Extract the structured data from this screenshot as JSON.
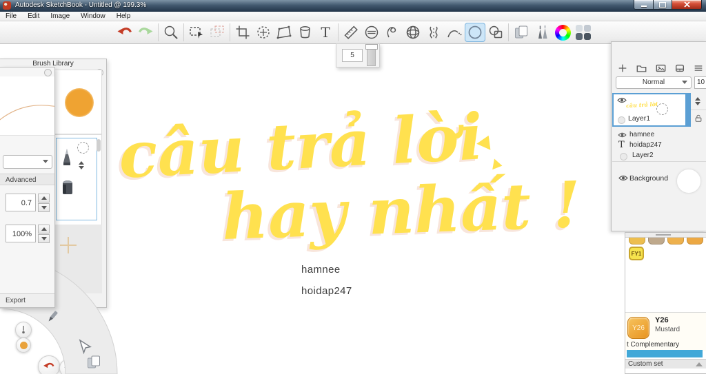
{
  "window": {
    "title": "Autodesk SketchBook - Untitled @ 199.3%"
  },
  "menu_bar": {
    "items": [
      "File",
      "Edit",
      "Image",
      "Window",
      "Help"
    ]
  },
  "toolbar": {
    "icons": [
      "undo",
      "redo",
      "zoom",
      "selection",
      "deselect",
      "crop",
      "transform",
      "distort",
      "fill",
      "text",
      "ruler",
      "ellipse-guide",
      "french-curve",
      "perspective",
      "symmetry",
      "steady-stroke",
      "ellipse",
      "shapes",
      "layer-copy",
      "brush-palette",
      "color-wheel",
      "swatch-grid"
    ],
    "active_tool": "ellipse"
  },
  "glyphs": {
    "text_tool": "T",
    "text_layer": "T"
  },
  "brush_size_popup": {
    "value": "5"
  },
  "brush_library_panel": {
    "title": "Brush Library"
  },
  "brush_properties_panel": {
    "advanced_label": "Advanced",
    "rotation_value": "0.7",
    "size_value": "100%",
    "export_label": "Export"
  },
  "canvas": {
    "lettering_line1": "câu trả lời",
    "lettering_line2": "hay nhất !",
    "lettering_color": "#ffe14f",
    "credit_line1": "hamnee",
    "credit_line2": "hoidap247"
  },
  "layers_panel": {
    "blend_mode": "Normal",
    "opacity_value": "10",
    "layers": [
      {
        "name": "Layer1"
      },
      {
        "name": "hamnee"
      },
      {
        "name": "hoidap247"
      },
      {
        "name": "Layer2"
      },
      {
        "name": "Background"
      }
    ]
  },
  "swatch_panel": {
    "partial_swatch_colors": [
      "#edbe4e",
      "#bfa98c",
      "#eeb14d",
      "#eca843"
    ],
    "fy1_label": "FY1",
    "selected_code": "Y26",
    "selected_name": "Mustard",
    "complementary_label": "t Complementary",
    "bar_color": "#41a8d8",
    "custom_set_label": "Custom set"
  }
}
